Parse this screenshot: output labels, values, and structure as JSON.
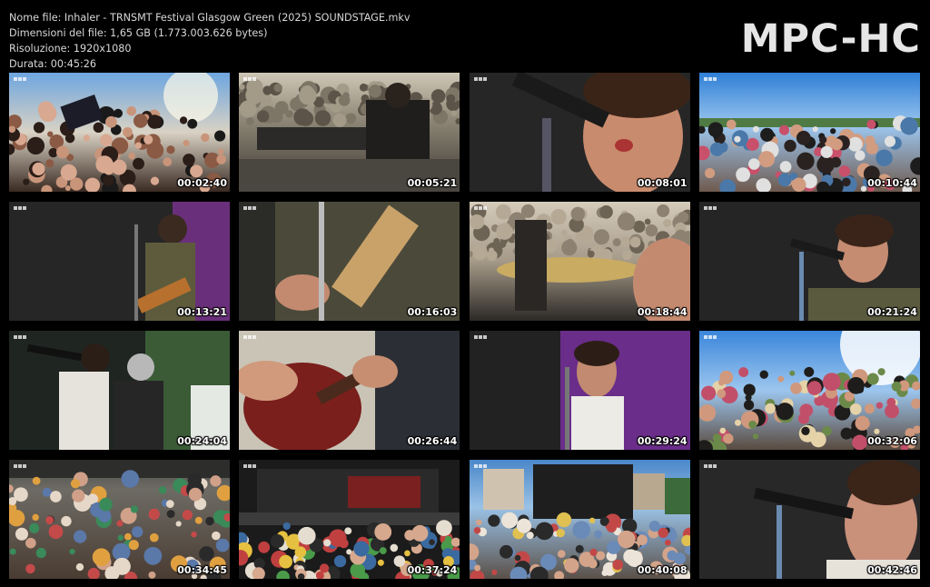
{
  "header": {
    "file_name": "Nome file: Inhaler - TRNSMT Festival Glasgow Green (2025) SOUNDSTAGE.mkv",
    "file_size": "Dimensioni del file: 1,65 GB (1.773.003.626 bytes)",
    "resolution": "Risoluzione: 1920x1080",
    "duration": "Durata: 00:45:26"
  },
  "logo": "MPC-HC",
  "thumbnails": [
    {
      "timestamp": "00:02:40",
      "scene": "crowd-hands-sunny"
    },
    {
      "timestamp": "00:05:21",
      "scene": "keyboard-player-stage"
    },
    {
      "timestamp": "00:08:01",
      "scene": "singer-closeup-mic"
    },
    {
      "timestamp": "00:10:44",
      "scene": "crowd-cheering-sky"
    },
    {
      "timestamp": "00:13:21",
      "scene": "guitarist-purple-screen"
    },
    {
      "timestamp": "00:16:03",
      "scene": "guitar-closeup-mic"
    },
    {
      "timestamp": "00:18:44",
      "scene": "drum-cymbal-crowd"
    },
    {
      "timestamp": "00:21:24",
      "scene": "singer-mic-dark"
    },
    {
      "timestamp": "00:24:04",
      "scene": "two-musicians-mic"
    },
    {
      "timestamp": "00:26:44",
      "scene": "red-guitar-closeup"
    },
    {
      "timestamp": "00:29:24",
      "scene": "singer-purple-screen"
    },
    {
      "timestamp": "00:32:06",
      "scene": "crowd-sun-flare"
    },
    {
      "timestamp": "00:34:45",
      "scene": "crowd-arms-raised"
    },
    {
      "timestamp": "00:37:24",
      "scene": "stage-wide-crowd"
    },
    {
      "timestamp": "00:40:08",
      "scene": "stage-screens-crowd"
    },
    {
      "timestamp": "00:42:46",
      "scene": "singer-mic-closeup-dark"
    }
  ]
}
